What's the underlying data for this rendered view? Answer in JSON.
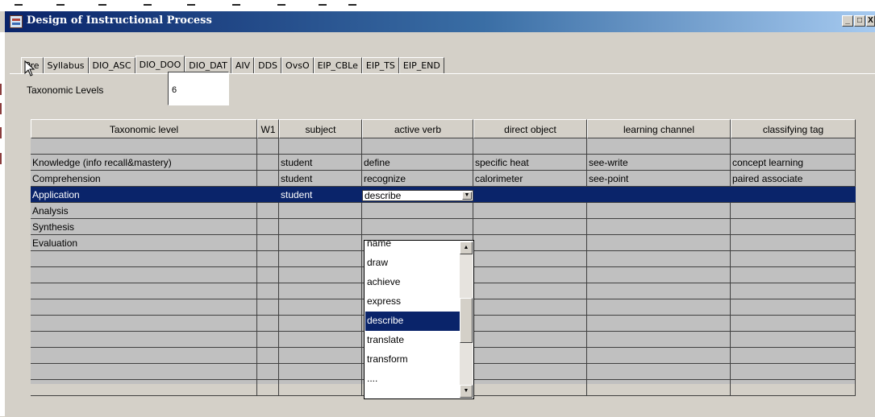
{
  "window": {
    "title": "Design of Instructional Process",
    "controls": {
      "minimize": "_",
      "maximize": "□",
      "close": "X"
    }
  },
  "tabs": [
    {
      "label": "Pre",
      "active": false
    },
    {
      "label": "Syllabus",
      "active": false
    },
    {
      "label": "DIO_ASC",
      "active": false
    },
    {
      "label": "DIO_DOO",
      "active": true
    },
    {
      "label": "DIO_DAT",
      "active": false
    },
    {
      "label": "AIV",
      "active": false
    },
    {
      "label": "DDS",
      "active": false
    },
    {
      "label": "OvsO",
      "active": false
    },
    {
      "label": "EIP_CBLe",
      "active": false
    },
    {
      "label": "EIP_TS",
      "active": false
    },
    {
      "label": "EIP_END",
      "active": false
    }
  ],
  "taxonomic_levels": {
    "label": "Taxonomic Levels",
    "value": "6"
  },
  "table": {
    "headers": [
      "Taxonomic level",
      "W1",
      "subject",
      "active verb",
      "direct object",
      "learning channel",
      "classifying tag"
    ],
    "rows": [
      [
        "",
        "",
        "",
        "",
        "",
        "",
        ""
      ],
      [
        "Knowledge (info recall&mastery)",
        "",
        "student",
        "define",
        "specific heat",
        "see-write",
        "concept learning"
      ],
      [
        "Comprehension",
        "",
        "student",
        "recognize",
        "calorimeter",
        "see-point",
        "paired associate"
      ],
      [
        "Application",
        "",
        "student",
        "",
        "",
        "",
        ""
      ],
      [
        "Analysis",
        "",
        "",
        "",
        "",
        "",
        ""
      ],
      [
        "Synthesis",
        "",
        "",
        "",
        "",
        "",
        ""
      ],
      [
        "Evaluation",
        "",
        "",
        "",
        "",
        "",
        ""
      ],
      [
        "",
        "",
        "",
        "",
        "",
        "",
        ""
      ],
      [
        "",
        "",
        "",
        "",
        "",
        "",
        ""
      ],
      [
        "",
        "",
        "",
        "",
        "",
        "",
        ""
      ],
      [
        "",
        "",
        "",
        "",
        "",
        "",
        ""
      ],
      [
        "",
        "",
        "",
        "",
        "",
        "",
        ""
      ],
      [
        "",
        "",
        "",
        "",
        "",
        "",
        ""
      ],
      [
        "",
        "",
        "",
        "",
        "",
        "",
        ""
      ],
      [
        "",
        "",
        "",
        "",
        "",
        "",
        ""
      ],
      [
        "",
        "",
        "",
        "",
        "",
        "",
        ""
      ]
    ],
    "selected_row": 3,
    "editor_value": "describe"
  },
  "dropdown": {
    "options": [
      "name",
      "draw",
      "achieve",
      "express",
      "describe",
      "translate",
      "transform",
      "...."
    ],
    "selected": "describe"
  },
  "colors": {
    "selection": "#0a246a",
    "grid": "#c0c0c0",
    "face": "#d4d0c8"
  }
}
